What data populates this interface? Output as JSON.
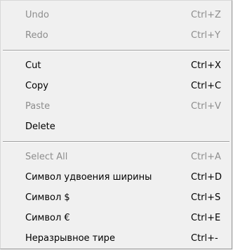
{
  "menu": {
    "groups": [
      {
        "items": [
          {
            "label": "Undo",
            "shortcut": "Ctrl+Z",
            "enabled": false
          },
          {
            "label": "Redo",
            "shortcut": "Ctrl+Y",
            "enabled": false
          }
        ]
      },
      {
        "items": [
          {
            "label": "Cut",
            "shortcut": "Ctrl+X",
            "enabled": true
          },
          {
            "label": "Copy",
            "shortcut": "Ctrl+C",
            "enabled": true
          },
          {
            "label": "Paste",
            "shortcut": "Ctrl+V",
            "enabled": false
          },
          {
            "label": "Delete",
            "shortcut": "",
            "enabled": true
          }
        ]
      },
      {
        "items": [
          {
            "label": "Select All",
            "shortcut": "Ctrl+A",
            "enabled": false
          },
          {
            "label": "Символ удвоения ширины",
            "shortcut": "Ctrl+D",
            "enabled": true
          },
          {
            "label": "Символ $",
            "shortcut": "Ctrl+S",
            "enabled": true
          },
          {
            "label": "Символ €",
            "shortcut": "Ctrl+E",
            "enabled": true
          },
          {
            "label": "Неразрывное тире",
            "shortcut": "Ctrl+-",
            "enabled": true
          }
        ]
      }
    ]
  }
}
